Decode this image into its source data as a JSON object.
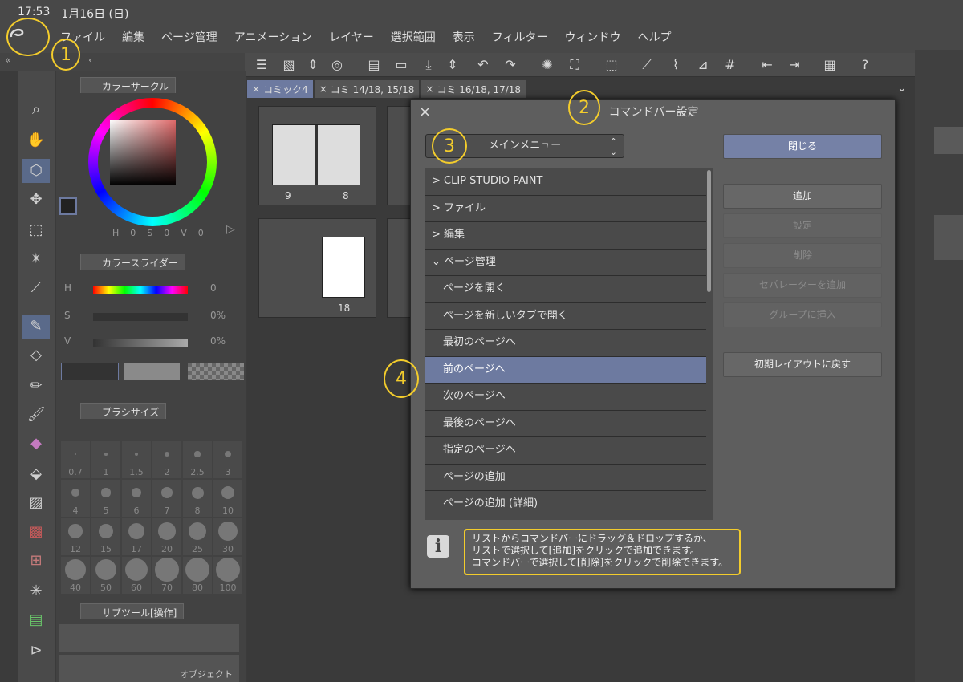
{
  "status": {
    "time": "17:53",
    "date": "1月16日 (日)"
  },
  "menu": [
    "ファイル",
    "編集",
    "ページ管理",
    "アニメーション",
    "レイヤー",
    "選択範囲",
    "表示",
    "フィルター",
    "ウィンドウ",
    "ヘルプ"
  ],
  "tabs": [
    {
      "label": "コミック4",
      "active": true
    },
    {
      "label": "コミ 14/18, 15/18",
      "active": false
    },
    {
      "label": "コミ 16/18, 17/18",
      "active": false
    }
  ],
  "panels": {
    "color_circle": "カラーサークル",
    "color_slider": "カラースライダー",
    "brush_size": "ブラシサイズ",
    "subtool": "サブツール[操作]",
    "object": "オブジェクト",
    "hsv_labels": [
      "H",
      "0",
      "S",
      "0",
      "V",
      "0"
    ],
    "slider_labels": {
      "h": "H",
      "s": "S",
      "v": "V",
      "h_val": "0",
      "s_val": "0%",
      "v_val": "0%"
    },
    "brush_sizes": [
      "0.7",
      "1",
      "1.5",
      "2",
      "2.5",
      "3",
      "4",
      "5",
      "6",
      "7",
      "8",
      "10",
      "12",
      "15",
      "17",
      "20",
      "25",
      "30",
      "40",
      "50",
      "60",
      "70",
      "80",
      "100"
    ]
  },
  "thumbnails": {
    "page_a": "9",
    "page_b": "8",
    "page_c": "18"
  },
  "dialog": {
    "title": "コマンドバー設定",
    "dropdown_value": "メインメニュー",
    "list": [
      {
        "label": "CLIP STUDIO PAINT",
        "prefix": ">",
        "indent": false,
        "selected": false
      },
      {
        "label": "ファイル",
        "prefix": ">",
        "indent": false,
        "selected": false
      },
      {
        "label": "編集",
        "prefix": ">",
        "indent": false,
        "selected": false
      },
      {
        "label": "ページ管理",
        "prefix": "⌄",
        "indent": false,
        "selected": false
      },
      {
        "label": "ページを開く",
        "prefix": "",
        "indent": true,
        "selected": false
      },
      {
        "label": "ページを新しいタブで開く",
        "prefix": "",
        "indent": true,
        "selected": false
      },
      {
        "label": "最初のページへ",
        "prefix": "",
        "indent": true,
        "selected": false
      },
      {
        "label": "前のページへ",
        "prefix": "",
        "indent": true,
        "selected": true
      },
      {
        "label": "次のページへ",
        "prefix": "",
        "indent": true,
        "selected": false
      },
      {
        "label": "最後のページへ",
        "prefix": "",
        "indent": true,
        "selected": false
      },
      {
        "label": "指定のページへ",
        "prefix": "",
        "indent": true,
        "selected": false
      },
      {
        "label": "ページの追加",
        "prefix": "",
        "indent": true,
        "selected": false
      },
      {
        "label": "ページの追加 (詳細)",
        "prefix": "",
        "indent": true,
        "selected": false
      }
    ],
    "buttons": {
      "close": "閉じる",
      "add": "追加",
      "settings": "設定",
      "delete": "削除",
      "add_separator": "セパレーターを追加",
      "insert_group": "グループに挿入",
      "reset_layout": "初期レイアウトに戻す"
    },
    "info": "リストからコマンドバーにドラッグ＆ドロップするか、\nリストで選択して[追加]をクリックで追加できます。\nコマンドバーで選択して[削除]をクリックで削除できます。"
  },
  "annotations": [
    "1",
    "2",
    "3",
    "4"
  ],
  "colors": {
    "accent": "#6d7aa0",
    "highlight": "#f3cc2c"
  }
}
